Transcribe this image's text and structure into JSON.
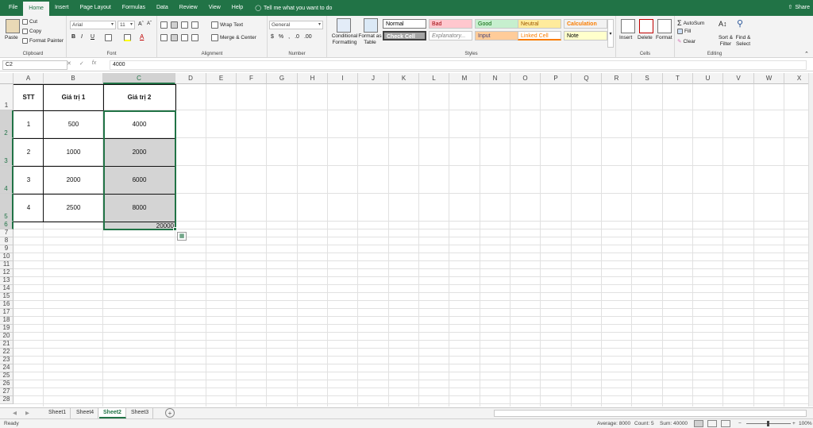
{
  "ribbon_tabs": [
    "File",
    "Home",
    "Insert",
    "Page Layout",
    "Formulas",
    "Data",
    "Review",
    "View",
    "Help"
  ],
  "tell_me": "Tell me what you want to do",
  "share": "Share",
  "clipboard": {
    "paste": "Paste",
    "cut": "Cut",
    "copy": "Copy",
    "format_painter": "Format Painter",
    "label": "Clipboard"
  },
  "font": {
    "name": "Arial",
    "size": "11",
    "label": "Font"
  },
  "alignment": {
    "wrap": "Wrap Text",
    "merge": "Merge & Center",
    "label": "Alignment"
  },
  "number": {
    "format": "General",
    "label": "Number"
  },
  "styles": {
    "conditional": "Conditional Formatting",
    "format_table": "Format as Table",
    "items": [
      {
        "name": "Normal",
        "bg": "#ffffff",
        "fg": "#000000"
      },
      {
        "name": "Bad",
        "bg": "#ffc7ce",
        "fg": "#9c0006"
      },
      {
        "name": "Good",
        "bg": "#c6efce",
        "fg": "#006100"
      },
      {
        "name": "Neutral",
        "bg": "#ffeb9c",
        "fg": "#9c5700"
      },
      {
        "name": "Calculation",
        "bg": "#f2f2f2",
        "fg": "#fa7d00"
      },
      {
        "name": "Check Cell",
        "bg": "#a5a5a5",
        "fg": "#ffffff"
      },
      {
        "name": "Explanatory...",
        "bg": "#ffffff",
        "fg": "#7f7f7f"
      },
      {
        "name": "Input",
        "bg": "#ffcc99",
        "fg": "#3f3f76"
      },
      {
        "name": "Linked Cell",
        "bg": "#ffffff",
        "fg": "#fa7d00"
      },
      {
        "name": "Note",
        "bg": "#ffffcc",
        "fg": "#000000"
      }
    ],
    "label": "Styles"
  },
  "cells_group": {
    "insert": "Insert",
    "delete": "Delete",
    "format": "Format",
    "label": "Cells"
  },
  "editing": {
    "autosum": "AutoSum",
    "fill": "Fill",
    "clear": "Clear",
    "sort": "Sort & Filter",
    "find": "Find & Select",
    "label": "Editing"
  },
  "name_box": "C2",
  "formula": "4000",
  "columns": [
    "A",
    "B",
    "C",
    "D",
    "E",
    "F",
    "G",
    "H",
    "I",
    "J",
    "K",
    "L",
    "M",
    "N",
    "O",
    "P",
    "Q",
    "R",
    "S",
    "T",
    "U",
    "V",
    "W",
    "X"
  ],
  "rows": [
    "1",
    "2",
    "3",
    "4",
    "5",
    "6",
    "7",
    "8",
    "9",
    "10",
    "11",
    "12",
    "13",
    "14",
    "15",
    "16",
    "17",
    "18",
    "19",
    "20",
    "21",
    "22",
    "23",
    "24",
    "25",
    "26",
    "27",
    "28"
  ],
  "table": {
    "headers": [
      "STT",
      "Giá trị 1",
      "Giá trị 2"
    ],
    "data": [
      [
        "1",
        "500",
        "4000"
      ],
      [
        "2",
        "1000",
        "2000"
      ],
      [
        "3",
        "2000",
        "6000"
      ],
      [
        "4",
        "2500",
        "8000"
      ]
    ],
    "sum": "20000"
  },
  "sheets": [
    "Sheet1",
    "Sheet4",
    "Sheet2",
    "Sheet3"
  ],
  "active_sheet": "Sheet2",
  "status": {
    "ready": "Ready",
    "average": "Average: 8000",
    "count": "Count: 5",
    "sum": "Sum: 40000",
    "zoom": "100%"
  }
}
